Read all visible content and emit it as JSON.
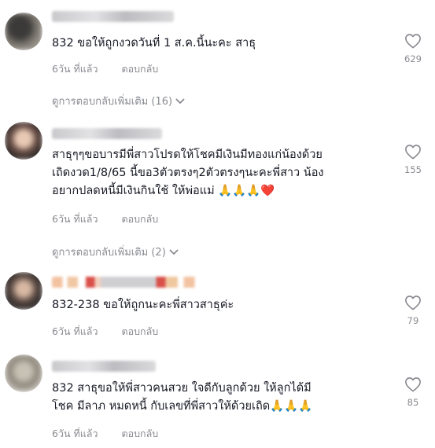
{
  "comments": [
    {
      "text": "832 ขอให้ถูกงวดวันที่ 1 ส.ค.นี้นะคะ สาธุ",
      "time": "6วัน ที่แล้ว",
      "reply_label": "ตอบกลับ",
      "likes": "629",
      "more_replies": "ดูการตอบกลับเพิ่มเติม (16)"
    },
    {
      "text": "สาธุๆๆขอบารมีพี่สาวโปรดให้โชคมีเงินมีทองแก่น้องด้วย\nเถิดงวด1/8/65 นี้ขอ3ตัวตรงๆ2ตัวตรงๆนะคะพี่สาว น้อง\nอยากปลดหนี้มีเงินกินใช้ ให้พ่อแม่ 🙏🙏🙏❤️",
      "time": "6วัน ที่แล้ว",
      "reply_label": "ตอบกลับ",
      "likes": "155",
      "more_replies": "ดูการตอบกลับเพิ่มเติม (2)"
    },
    {
      "text": "832-238 ขอให้ถูกนะคะพี่สาวสาธุค่ะ",
      "time": "6วัน ที่แล้ว",
      "reply_label": "ตอบกลับ",
      "likes": "79"
    },
    {
      "text": "832 สาธุขอให้พี่สาวคนสวย ใจดีกับลูกด้วย ให้ลูกได้มี\nโชค มีลาภ หมดหนี้ กับเลขที่พี่สาวให้ด้วยเถิด🙏🙏🙏",
      "time": "6วัน ที่แล้ว",
      "reply_label": "ตอบกลับ",
      "likes": "85"
    }
  ],
  "icons": {
    "like": "heart-outline-icon",
    "expand": "chevron-down-icon"
  },
  "colors": {
    "text": "#161823",
    "muted": "#8a8b91"
  }
}
